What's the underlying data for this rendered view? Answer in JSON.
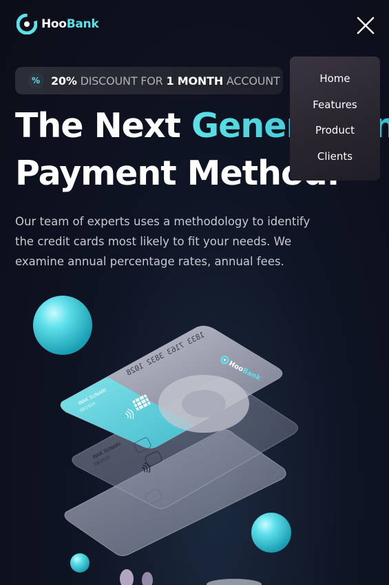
{
  "header": {
    "logo_prefix": "Hoo",
    "logo_suffix": "Bank",
    "menu_items": [
      "Home",
      "Features",
      "Product",
      "Clients"
    ]
  },
  "promo": {
    "percent": "20%",
    "text1": " DISCOUNT FOR ",
    "months": "1 MONTH",
    "text2": " ACCOUNT"
  },
  "hero": {
    "line1_plain": "The Next ",
    "line1_accent": "Generation",
    "line2": "Payment Method.",
    "description": "Our team of experts uses a methodology to identify the credit cards most likely to fit your needs. We examine annual percentage rates, annual fees."
  },
  "cards": {
    "number": "1833 7163 3832 1028",
    "holder_a": "WAK SUNARI",
    "expiry_a": "08/2024",
    "holder_b": "WAK SUNARI",
    "expiry_b": "08/2024",
    "brand_prefix": "Hoo",
    "brand_suffix": "Bank"
  },
  "colors": {
    "accent": "#5ce1e6",
    "background": "#0f1424"
  }
}
